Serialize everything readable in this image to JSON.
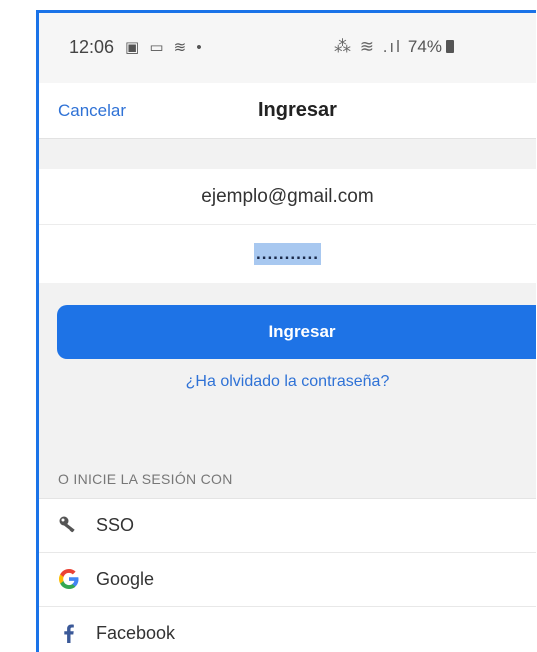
{
  "status_bar": {
    "time": "12:06",
    "left_icons": "▣ ▭ ≋ •",
    "right_icons": "⁂ ≋ .ıl",
    "battery": "74%"
  },
  "nav": {
    "cancel_label": "Cancelar",
    "title": "Ingresar"
  },
  "form": {
    "email_value": "ejemplo@gmail.com",
    "password_mask": "..........."
  },
  "login_button_label": "Ingresar",
  "forgot_link": "¿Ha olvidado la contraseña?",
  "alt_login": {
    "section_label": "O INICIE LA SESIÓN CON",
    "items": [
      {
        "label": "SSO",
        "icon": "key-icon"
      },
      {
        "label": "Google",
        "icon": "google-icon"
      },
      {
        "label": "Facebook",
        "icon": "facebook-icon"
      }
    ]
  },
  "colors": {
    "accent": "#1e73e6",
    "link": "#2f72d6",
    "facebook": "#3b5998",
    "google": "#4285f4"
  }
}
